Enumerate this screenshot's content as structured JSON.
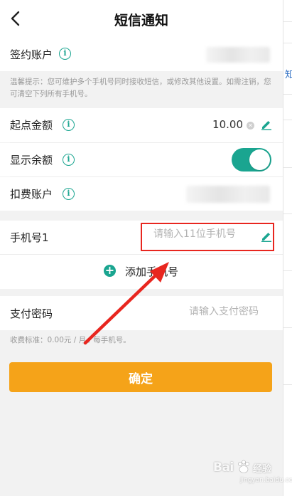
{
  "header": {
    "title": "短信通知"
  },
  "account": {
    "label": "签约账户"
  },
  "tip": {
    "text": "温馨提示：您可维护多个手机号同时接收短信，或修改其他设置。如需注销，您可清空下列所有手机号。"
  },
  "threshold": {
    "label": "起点金额",
    "value": "10.00"
  },
  "show_balance": {
    "label": "显示余额",
    "enabled": true
  },
  "fee_account": {
    "label": "扣费账户"
  },
  "phone": {
    "label": "手机号1",
    "placeholder": "请输入11位手机号"
  },
  "add_phone": {
    "label": "添加手机号"
  },
  "password": {
    "label": "支付密码",
    "placeholder": "请输入支付密码"
  },
  "fee_note": {
    "text": "收费标准：0.00元 / 月 / 每手机号。"
  },
  "confirm": {
    "label": "确定"
  },
  "side_strip": {
    "text": "知"
  },
  "watermark": {
    "brand": "Bai",
    "suffix": "经验",
    "url": "jingyan.baidu.com"
  },
  "colors": {
    "accent": "#1aa590",
    "button": "#f5a319",
    "highlight": "#e8261f",
    "hint": "#999999"
  }
}
